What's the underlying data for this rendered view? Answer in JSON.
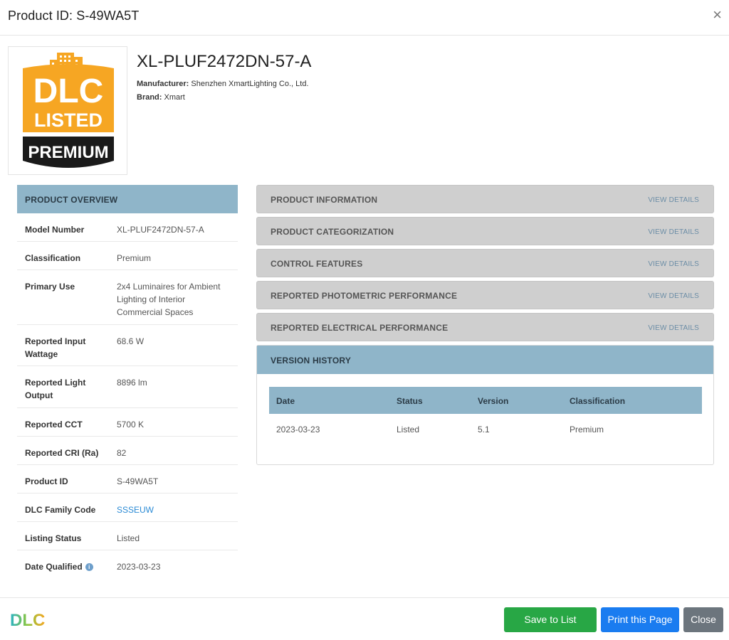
{
  "modal": {
    "title": "Product ID: S-49WA5T",
    "close_glyph": "×"
  },
  "logo": {
    "line1": "DLC",
    "line2": "LISTED",
    "line3": "PREMIUM",
    "colors": {
      "orange": "#f6a623",
      "black": "#1a1a1a",
      "white": "#ffffff"
    }
  },
  "product": {
    "name": "XL-PLUF2472DN-57-A",
    "manufacturer_label": "Manufacturer:",
    "manufacturer": "Shenzhen XmartLighting Co., Ltd.",
    "brand_label": "Brand:",
    "brand": "Xmart"
  },
  "overview": {
    "heading": "PRODUCT OVERVIEW",
    "rows": [
      {
        "key": "Model Number",
        "value": "XL-PLUF2472DN-57-A"
      },
      {
        "key": "Classification",
        "value": "Premium"
      },
      {
        "key": "Primary Use",
        "value": "2x4 Luminaires for Ambient Lighting of Interior Commercial Spaces"
      },
      {
        "key": "Reported Input Wattage",
        "value": "68.6 W"
      },
      {
        "key": "Reported Light Output",
        "value": "8896 lm"
      },
      {
        "key": "Reported CCT",
        "value": "5700 K"
      },
      {
        "key": "Reported CRI (Ra)",
        "value": "82"
      },
      {
        "key": "Product ID",
        "value": "S-49WA5T"
      },
      {
        "key": "DLC Family Code",
        "value": "SSSEUW"
      },
      {
        "key": "Listing Status",
        "value": "Listed"
      },
      {
        "key": "Date Qualified",
        "value": "2023-03-23"
      }
    ]
  },
  "sections": {
    "view_details": "VIEW DETAILS",
    "items": [
      {
        "title": "PRODUCT INFORMATION"
      },
      {
        "title": "PRODUCT CATEGORIZATION"
      },
      {
        "title": "CONTROL FEATURES"
      },
      {
        "title": "REPORTED PHOTOMETRIC PERFORMANCE"
      },
      {
        "title": "REPORTED ELECTRICAL PERFORMANCE"
      }
    ],
    "version_history": {
      "title": "VERSION HISTORY",
      "columns": [
        "Date",
        "Status",
        "Version",
        "Classification"
      ],
      "rows": [
        [
          "2023-03-23",
          "Listed",
          "5.1",
          "Premium"
        ]
      ]
    }
  },
  "footer": {
    "brand": "DLC",
    "save_label": "Save to List",
    "print_label": "Print this Page",
    "close_label": "Close"
  },
  "colors": {
    "header_blue": "#8fb5c9",
    "save_green": "#28a745",
    "print_blue": "#1a7cf0",
    "close_gray": "#6c757d",
    "link_blue": "#2a8ad5"
  }
}
